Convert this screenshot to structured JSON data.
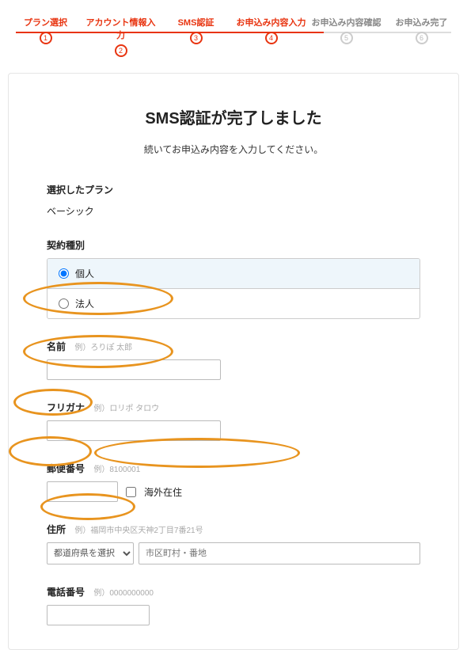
{
  "progress": {
    "steps": [
      {
        "label": "プラン選択",
        "num": "1",
        "active": true
      },
      {
        "label": "アカウント情報入力",
        "num": "2",
        "active": true
      },
      {
        "label": "SMS認証",
        "num": "3",
        "active": true
      },
      {
        "label": "お申込み内容入力",
        "num": "4",
        "active": true
      },
      {
        "label": "お申込み内容確認",
        "num": "5",
        "active": false
      },
      {
        "label": "お申込み完了",
        "num": "6",
        "active": false
      }
    ],
    "fill_percent": 66
  },
  "heading": "SMS認証が完了しました",
  "subtitle": "続いてお申込み内容を入力してください。",
  "plan": {
    "label": "選択したプラン",
    "value": "ベーシック"
  },
  "contract_type": {
    "label": "契約種別",
    "options": [
      {
        "label": "個人",
        "checked": true
      },
      {
        "label": "法人",
        "checked": false
      }
    ]
  },
  "name": {
    "label": "名前",
    "hint": "例）ろりぽ 太郎"
  },
  "kana": {
    "label": "フリガナ",
    "hint": "例）ロリポ タロウ"
  },
  "postal": {
    "label": "郵便番号",
    "hint": "例）8100001",
    "overseas": "海外在住"
  },
  "address": {
    "label": "住所",
    "hint": "例）福岡市中央区天神2丁目7番21号",
    "pref_placeholder": "都道府県を選択",
    "city_placeholder": "市区町村・番地"
  },
  "phone": {
    "label": "電話番号",
    "hint": "例）0000000000"
  }
}
